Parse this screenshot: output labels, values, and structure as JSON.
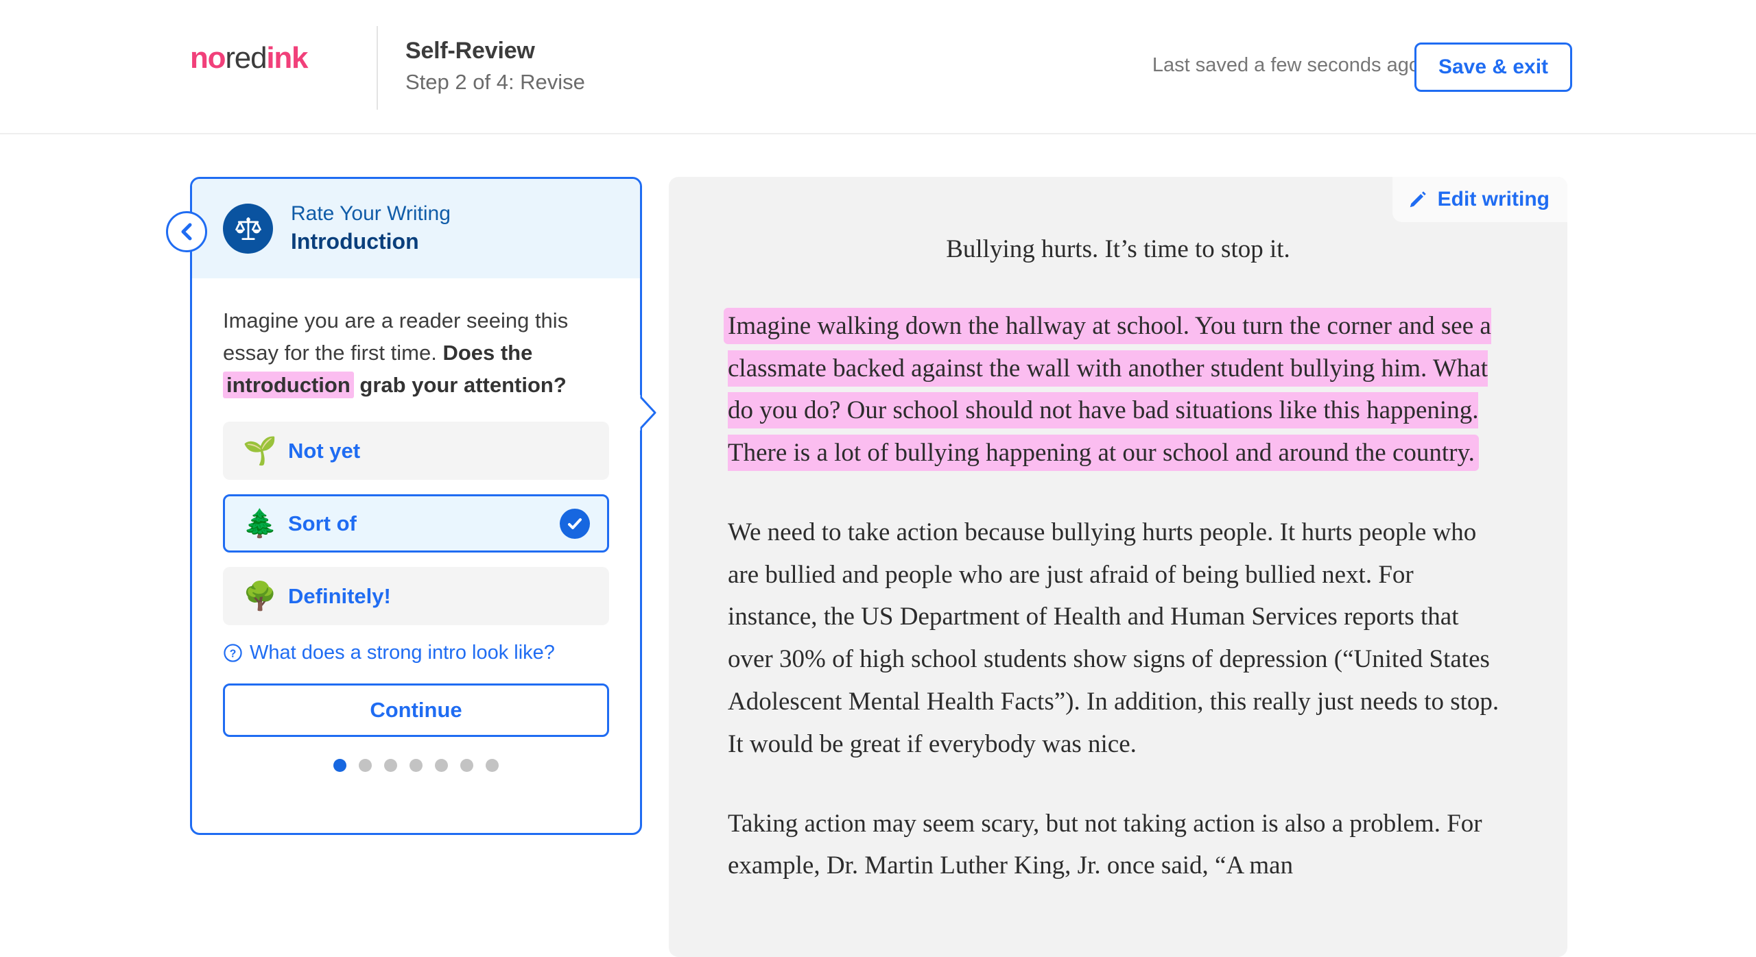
{
  "header": {
    "logo": {
      "part1": "no",
      "part2": "red",
      "part3": "ink"
    },
    "title": "Self-Review",
    "subtitle": "Step 2 of 4: Revise",
    "saved_status": "Last saved a few seconds ago",
    "save_exit_label": "Save & exit"
  },
  "card": {
    "eyebrow": "Rate Your Writing",
    "section": "Introduction",
    "question_part1": "Imagine you are a reader seeing this essay for the first time. ",
    "question_bold1": "Does the ",
    "question_highlight": "introduction",
    "question_bold2": " grab your attention?",
    "options": [
      {
        "emoji": "🌱",
        "icon_name": "seedling-emoji",
        "label": "Not yet",
        "selected": false
      },
      {
        "emoji": "🌲",
        "icon_name": "tree-emoji",
        "label": "Sort of",
        "selected": true
      },
      {
        "emoji": "🌳",
        "icon_name": "deciduous-tree-emoji",
        "label": "Definitely!",
        "selected": false
      }
    ],
    "help_link": "What does a strong intro look like?",
    "continue_label": "Continue",
    "progress": {
      "total": 7,
      "active_index": 0
    }
  },
  "right": {
    "edit_label": "Edit writing",
    "essay_title": "Bullying hurts. It’s time to stop it.",
    "paragraphs": [
      {
        "highlighted": true,
        "text": "Imagine walking down the hallway at school. You turn the corner and see a classmate backed against the wall with another student bullying him. What do you do? Our school should not have bad situations like this happening. There is a lot of bullying happening at our school and around the country."
      },
      {
        "highlighted": false,
        "text": "We need to take action because bullying hurts people. It hurts people who are bullied and people who are just afraid of being bullied next. For instance, the US Department of Health and Human Services reports that over 30% of high school students show signs of depression (“United States Adolescent Mental Health Facts”). In addition, this really just needs to stop. It would be great if everybody was nice."
      },
      {
        "highlighted": false,
        "text": "Taking action may seem scary, but not taking action is also a problem. For example, Dr. Martin Luther King, Jr. once said, “A man"
      }
    ]
  },
  "colors": {
    "brand_pink": "#f1407a",
    "accent_blue": "#1f6cf2",
    "navy": "#0a53a0",
    "highlight_pink": "#fbbdf0",
    "panel_gray": "#f2f2f2"
  }
}
